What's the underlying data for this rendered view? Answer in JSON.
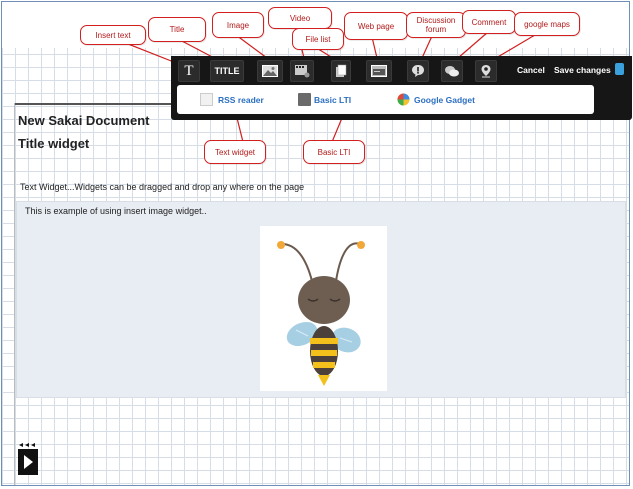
{
  "annotations": {
    "insert_text": "Insert text",
    "title": "Title",
    "image": "Image",
    "video": "Video",
    "file_list": "File list",
    "web_page": "Web page",
    "discussion_forum": "Discussion forum",
    "comment": "Comment",
    "google_maps": "google maps",
    "text_widget": "Text widget",
    "basic_lti": "Basic LTI"
  },
  "toolbar": {
    "title_button": "TITLE",
    "text_button": "T",
    "cancel": "Cancel",
    "save_changes": "Save changes"
  },
  "subbar": {
    "rss_reader": "RSS reader",
    "basic_lti": "Basic LTI",
    "google_gadget": "Google Gadget"
  },
  "document": {
    "title": "New Sakai Document",
    "title_widget": "Title widget",
    "text_widget": "Text Widget...Widgets can be dragged and drop any where on the page",
    "image_caption": "This is example of using insert image widget.."
  },
  "colors": {
    "callout_border": "#d21f1f",
    "toolbar_bg": "#161616",
    "link_blue": "#2c6fc1",
    "panel_bg": "#e8edf3"
  }
}
